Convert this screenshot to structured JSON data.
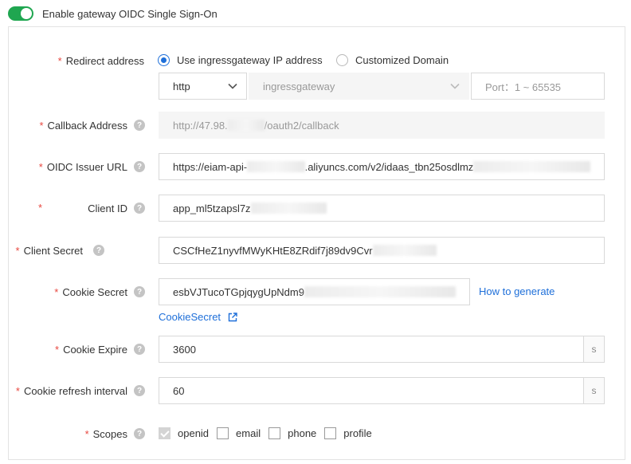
{
  "header": {
    "toggle_label": "Enable gateway OIDC Single Sign-On",
    "toggle_on": true
  },
  "redirect": {
    "label": "Redirect address",
    "option_ingress": "Use ingressgateway IP address",
    "option_custom": "Customized Domain",
    "protocol": "http",
    "gateway": "ingressgateway",
    "port_placeholder": "Port：1 ~ 65535"
  },
  "callback": {
    "label": "Callback Address",
    "value_a": "http://47.98.",
    "value_b": "/oauth2/callback"
  },
  "issuer": {
    "label": "OIDC Issuer URL",
    "value_a": "https://eiam-api-",
    "value_b": ".aliyuncs.com/v2/idaas_tbn25osdlmz"
  },
  "client_id": {
    "label": "Client ID",
    "value": "app_ml5tzapsl7z"
  },
  "client_secret": {
    "label": "Client Secret",
    "value": "CSCfHeZ1nyvfMWyKHtE8ZRdif7j89dv9Cvr"
  },
  "cookie_secret": {
    "label": "Cookie Secret",
    "value": "esbVJTucoTGpjqygUpNdm9",
    "how_link": "How to generate",
    "doc_link": "CookieSecret"
  },
  "cookie_expire": {
    "label": "Cookie Expire",
    "value": "3600",
    "suffix": "s"
  },
  "cookie_refresh": {
    "label": "Cookie refresh interval",
    "value": "60",
    "suffix": "s"
  },
  "scopes": {
    "label": "Scopes",
    "items": [
      "openid",
      "email",
      "phone",
      "profile"
    ]
  },
  "colors": {
    "accent": "#1e6fd9",
    "toggle": "#1fa650",
    "required": "#e8473f"
  }
}
